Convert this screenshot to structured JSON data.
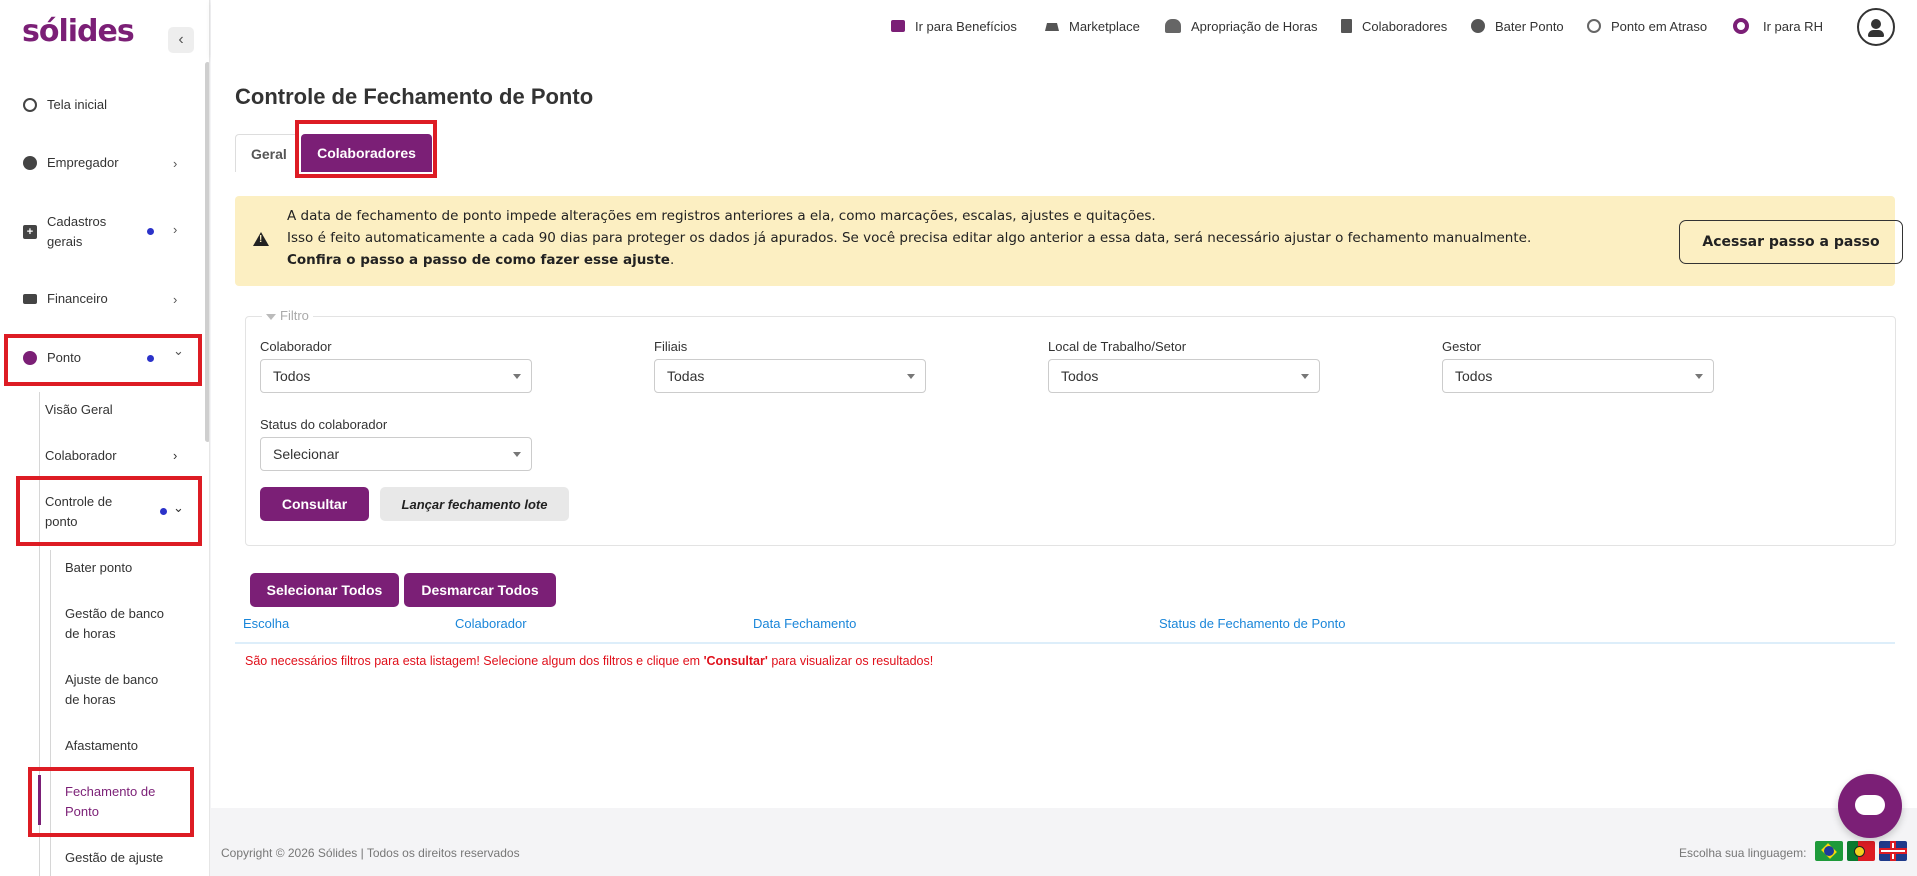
{
  "brand": {
    "logo": "sólides",
    "color": "#7b1f76"
  },
  "sidebar": {
    "collapse_icon": "‹",
    "items": [
      {
        "label": "Tela inicial",
        "icon": "globe-icon"
      },
      {
        "label": "Empregador",
        "icon": "user-icon",
        "chevron": "›"
      },
      {
        "label_line1": "Cadastros",
        "label_line2": "gerais",
        "icon": "plus-square-icon",
        "chevron": "›"
      },
      {
        "label": "Financeiro",
        "icon": "money-icon",
        "chevron": "›"
      },
      {
        "label": "Ponto",
        "icon": "clock-icon",
        "chevron": "⌄"
      }
    ],
    "ponto_sub": {
      "visao_geral": "Visão Geral",
      "colaborador": "Colaborador",
      "controle_line1": "Controle de",
      "controle_line2": "ponto",
      "chevron_right": "›",
      "chevron_down": "⌄"
    },
    "controle_sub": [
      {
        "line1": "Bater ponto"
      },
      {
        "line1": "Gestão de banco",
        "line2": "de horas"
      },
      {
        "line1": "Ajuste de banco",
        "line2": "de horas"
      },
      {
        "line1": "Afastamento"
      },
      {
        "line1": "Fechamento de",
        "line2": "Ponto"
      },
      {
        "line1": "Gestão de ajuste"
      }
    ]
  },
  "topbar": {
    "links": [
      {
        "label": "Ir para Benefícios",
        "icon": "wallet-icon"
      },
      {
        "label": "Marketplace",
        "icon": "cart-icon"
      },
      {
        "label": "Apropriação de Horas",
        "icon": "people-icon"
      },
      {
        "label": "Colaboradores",
        "icon": "book-icon"
      },
      {
        "label": "Bater Ponto",
        "icon": "clock-icon"
      },
      {
        "label": "Ponto em Atraso",
        "icon": "history-icon"
      },
      {
        "label": "Ir para RH",
        "icon": "solides-o-icon"
      }
    ]
  },
  "page": {
    "title": "Controle de Fechamento de Ponto",
    "tabs": {
      "geral": "Geral",
      "colaboradores": "Colaboradores"
    }
  },
  "alert": {
    "line1": "A data de fechamento de ponto impede alterações em registros anteriores a ela, como marcações, escalas, ajustes e quitações.",
    "line2": "Isso é feito automaticamente a cada 90 dias para proteger os dados já apurados. Se você precisa editar algo anterior a essa data, será necessário ajustar o fechamento manualmente.",
    "line3_bold": "Confira o passo a passo de como fazer esse ajuste",
    "line3_tail": ".",
    "button": "Acessar passo a passo"
  },
  "filter": {
    "legend": "Filtro",
    "colaborador": {
      "label": "Colaborador",
      "value": "Todos"
    },
    "filiais": {
      "label": "Filiais",
      "value": "Todas"
    },
    "local": {
      "label": "Local de Trabalho/Setor",
      "value": "Todos"
    },
    "gestor": {
      "label": "Gestor",
      "value": "Todos"
    },
    "status": {
      "label": "Status do colaborador",
      "value": "Selecionar"
    },
    "consultar": "Consultar",
    "lancar": "Lançar fechamento lote"
  },
  "table": {
    "select_all": "Selecionar Todos",
    "deselect_all": "Desmarcar Todos",
    "headers": [
      "Escolha",
      "Colaborador",
      "Data Fechamento",
      "Status de Fechamento de Ponto"
    ],
    "empty_pre": "São necessários filtros para esta listagem! Selecione algum dos filtros e clique em ",
    "empty_bold": "'Consultar'",
    "empty_post": " para visualizar os resultados!"
  },
  "footer": {
    "copyright": "Copyright © 2026 Sólides | Todos os direitos reservados",
    "language_label": "Escolha sua linguagem:"
  }
}
